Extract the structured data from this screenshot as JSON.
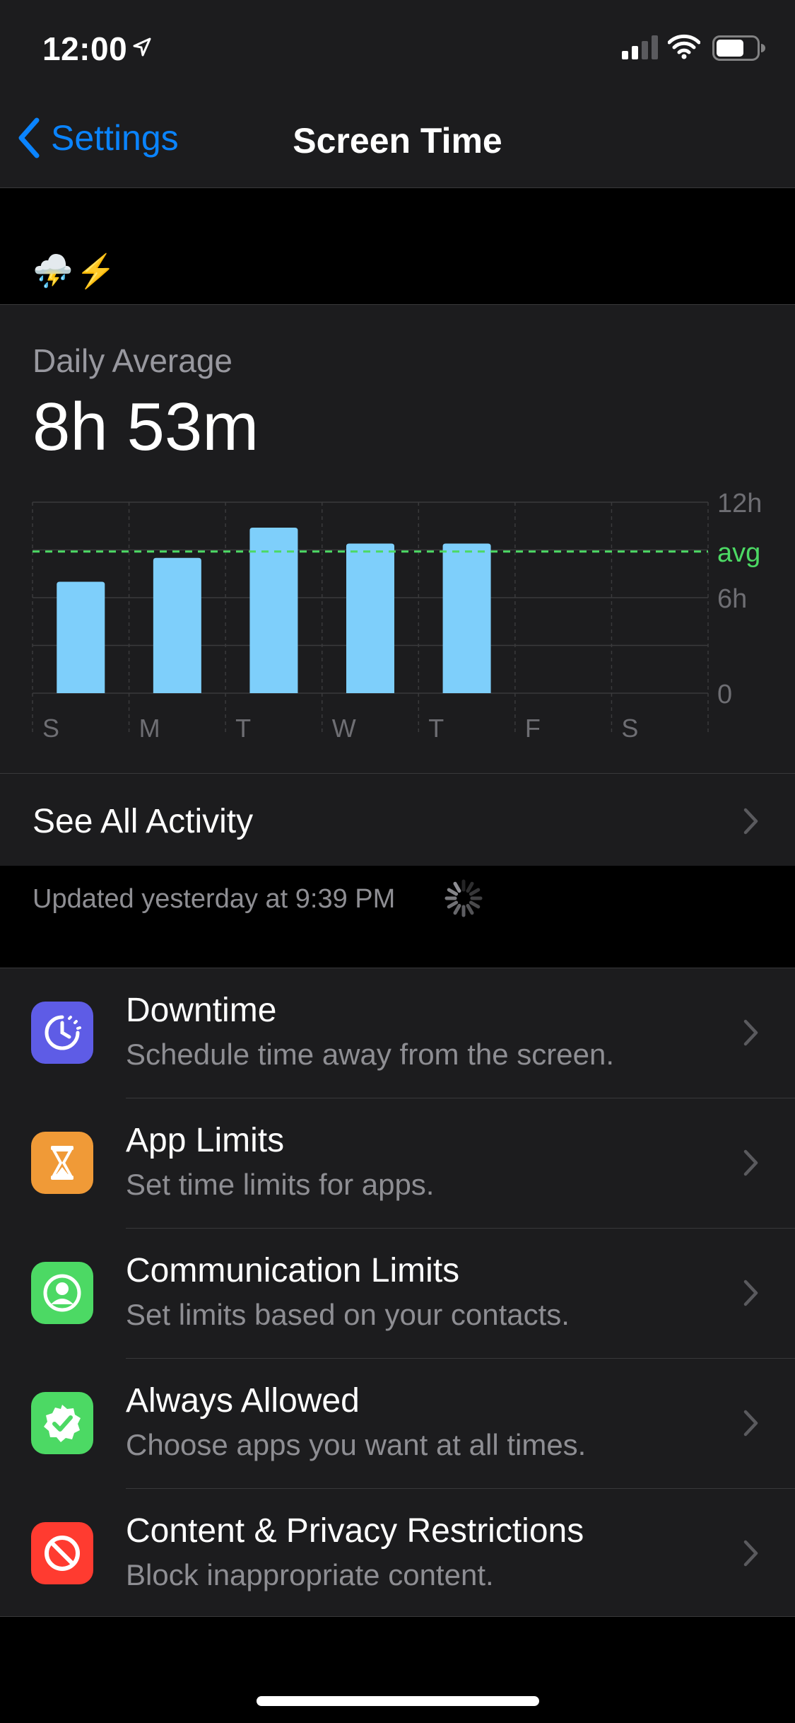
{
  "status_bar": {
    "time": "12:00",
    "location_icon": "location-arrow-icon",
    "signal_icon": "cellular-signal-icon",
    "wifi_icon": "wifi-icon",
    "battery_icon": "battery-icon"
  },
  "nav": {
    "back_label": "Settings",
    "title": "Screen Time"
  },
  "device": {
    "emoji": "⛈️⚡"
  },
  "summary": {
    "label": "Daily Average",
    "value": "8h 53m",
    "see_all": "See All Activity"
  },
  "chart_data": {
    "type": "bar",
    "categories": [
      "S",
      "M",
      "T",
      "W",
      "T",
      "F",
      "S"
    ],
    "values": [
      7.0,
      8.5,
      10.4,
      9.4,
      9.4,
      null,
      null
    ],
    "average": 8.9,
    "ylim": [
      0,
      12
    ],
    "yticks": [
      {
        "value": 12,
        "label": "12h"
      },
      {
        "value": 6,
        "label": "6h"
      },
      {
        "value": 0,
        "label": "0"
      }
    ],
    "avg_label": "avg",
    "colors": {
      "bar": "#7ecffb",
      "avg_line": "#4cd964",
      "grid": "#3a3a3c",
      "tick_text": "#6e6e73"
    }
  },
  "updated": "Updated yesterday at 9:39 PM",
  "menu": [
    {
      "title": "Downtime",
      "subtitle": "Schedule time away from the screen.",
      "icon": "downtime-icon",
      "color": "#5e5ce6"
    },
    {
      "title": "App Limits",
      "subtitle": "Set time limits for apps.",
      "icon": "hourglass-icon",
      "color": "#f09a37"
    },
    {
      "title": "Communication Limits",
      "subtitle": "Set limits based on your contacts.",
      "icon": "contact-icon",
      "color": "#4cd964"
    },
    {
      "title": "Always Allowed",
      "subtitle": "Choose apps you want at all times.",
      "icon": "checkmark-seal-icon",
      "color": "#4cd964"
    },
    {
      "title": "Content & Privacy Restrictions",
      "subtitle": "Block inappropriate content.",
      "icon": "no-entry-icon",
      "color": "#ff3b30"
    }
  ]
}
